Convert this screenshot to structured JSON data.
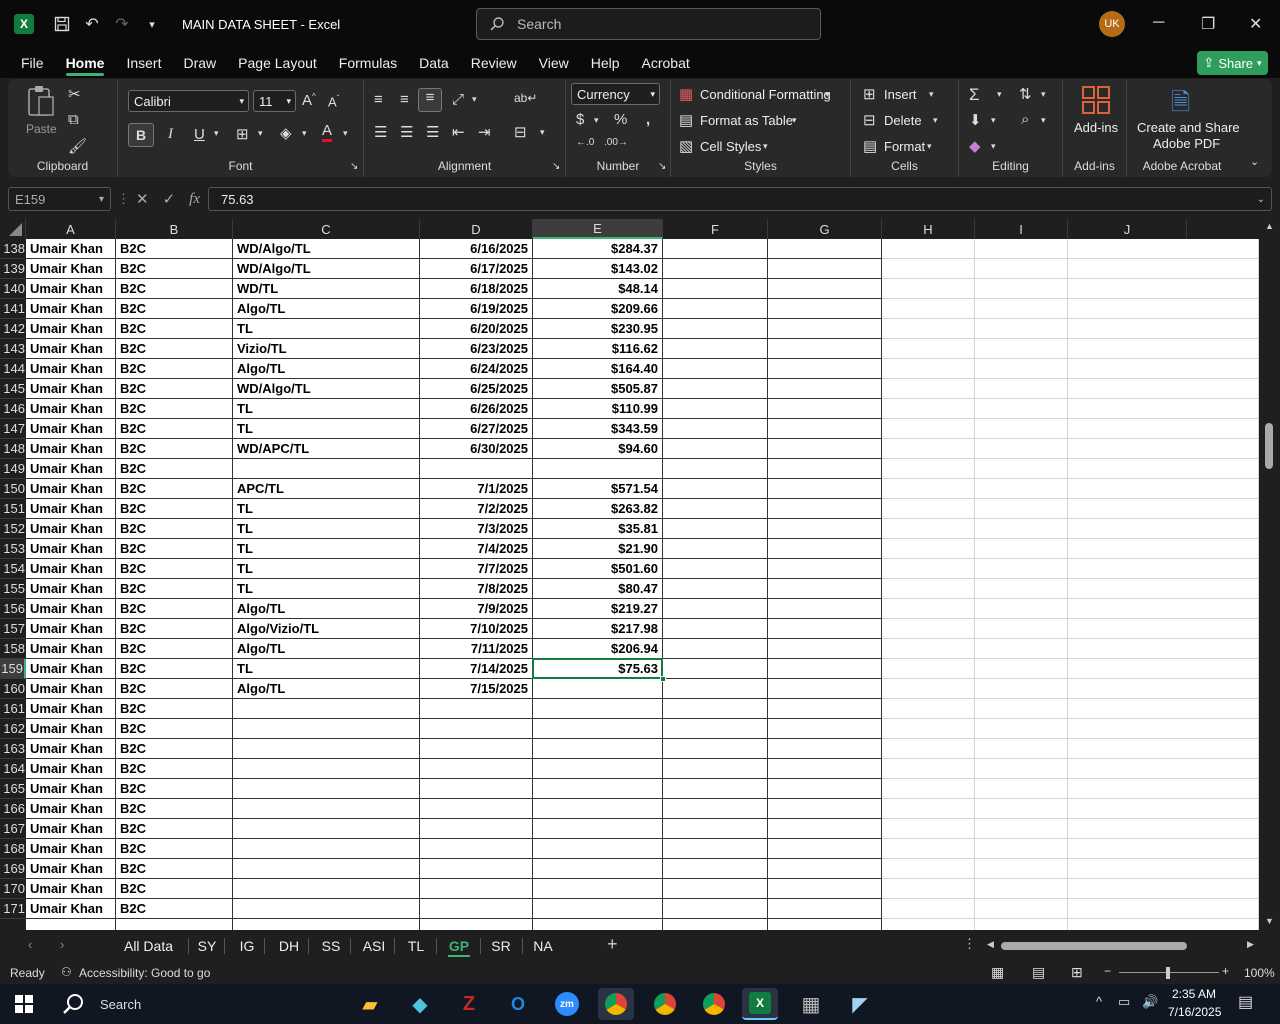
{
  "window": {
    "title": "MAIN DATA SHEET  -  Excel",
    "search_placeholder": "Search",
    "user_initials": "UK"
  },
  "menu": {
    "items": [
      "File",
      "Home",
      "Insert",
      "Draw",
      "Page Layout",
      "Formulas",
      "Data",
      "Review",
      "View",
      "Help",
      "Acrobat"
    ],
    "active": "Home",
    "share_label": "Share"
  },
  "ribbon": {
    "clipboard": {
      "label": "Clipboard",
      "paste": "Paste"
    },
    "font": {
      "label": "Font",
      "family": "Calibri",
      "size": "11",
      "bold": "B",
      "italic": "I",
      "underline": "U"
    },
    "alignment": {
      "label": "Alignment"
    },
    "number": {
      "label": "Number",
      "format": "Currency"
    },
    "styles": {
      "label": "Styles",
      "conditional": "Conditional Formatting",
      "table": "Format as Table",
      "cell_styles": "Cell Styles"
    },
    "cells": {
      "label": "Cells",
      "insert": "Insert",
      "delete": "Delete",
      "format": "Format"
    },
    "editing": {
      "label": "Editing"
    },
    "addins": {
      "label": "Add-ins",
      "button": "Add-ins"
    },
    "acrobat": {
      "label": "Adobe Acrobat",
      "button_line1": "Create and Share",
      "button_line2": "Adobe PDF"
    }
  },
  "formula_bar": {
    "name_box": "E159",
    "fx": "fx",
    "value": "75.63"
  },
  "columns": [
    "A",
    "B",
    "C",
    "D",
    "E",
    "F",
    "G",
    "H",
    "I",
    "J"
  ],
  "selected_column": "E",
  "selected_row": "159",
  "rows": [
    {
      "n": "138",
      "a": "Umair Khan",
      "b": "B2C",
      "c": "WD/Algo/TL",
      "d": "6/16/2025",
      "e": "$284.37"
    },
    {
      "n": "139",
      "a": "Umair Khan",
      "b": "B2C",
      "c": "WD/Algo/TL",
      "d": "6/17/2025",
      "e": "$143.02"
    },
    {
      "n": "140",
      "a": "Umair Khan",
      "b": "B2C",
      "c": "WD/TL",
      "d": "6/18/2025",
      "e": "$48.14"
    },
    {
      "n": "141",
      "a": "Umair Khan",
      "b": "B2C",
      "c": "Algo/TL",
      "d": "6/19/2025",
      "e": "$209.66"
    },
    {
      "n": "142",
      "a": "Umair Khan",
      "b": "B2C",
      "c": "TL",
      "d": "6/20/2025",
      "e": "$230.95"
    },
    {
      "n": "143",
      "a": "Umair Khan",
      "b": "B2C",
      "c": "Vizio/TL",
      "d": "6/23/2025",
      "e": "$116.62"
    },
    {
      "n": "144",
      "a": "Umair Khan",
      "b": "B2C",
      "c": "Algo/TL",
      "d": "6/24/2025",
      "e": "$164.40"
    },
    {
      "n": "145",
      "a": "Umair Khan",
      "b": "B2C",
      "c": "WD/Algo/TL",
      "d": "6/25/2025",
      "e": "$505.87"
    },
    {
      "n": "146",
      "a": "Umair Khan",
      "b": "B2C",
      "c": "TL",
      "d": "6/26/2025",
      "e": "$110.99"
    },
    {
      "n": "147",
      "a": "Umair Khan",
      "b": "B2C",
      "c": "TL",
      "d": "6/27/2025",
      "e": "$343.59"
    },
    {
      "n": "148",
      "a": "Umair Khan",
      "b": "B2C",
      "c": "WD/APC/TL",
      "d": "6/30/2025",
      "e": "$94.60"
    },
    {
      "n": "149",
      "a": "Umair Khan",
      "b": "B2C",
      "c": "",
      "d": "",
      "e": ""
    },
    {
      "n": "150",
      "a": "Umair Khan",
      "b": "B2C",
      "c": "APC/TL",
      "d": "7/1/2025",
      "e": "$571.54"
    },
    {
      "n": "151",
      "a": "Umair Khan",
      "b": "B2C",
      "c": "TL",
      "d": "7/2/2025",
      "e": "$263.82"
    },
    {
      "n": "152",
      "a": "Umair Khan",
      "b": "B2C",
      "c": "TL",
      "d": "7/3/2025",
      "e": "$35.81"
    },
    {
      "n": "153",
      "a": "Umair Khan",
      "b": "B2C",
      "c": "TL",
      "d": "7/4/2025",
      "e": "$21.90"
    },
    {
      "n": "154",
      "a": "Umair Khan",
      "b": "B2C",
      "c": "TL",
      "d": "7/7/2025",
      "e": "$501.60"
    },
    {
      "n": "155",
      "a": "Umair Khan",
      "b": "B2C",
      "c": "TL",
      "d": "7/8/2025",
      "e": "$80.47"
    },
    {
      "n": "156",
      "a": "Umair Khan",
      "b": "B2C",
      "c": "Algo/TL",
      "d": "7/9/2025",
      "e": "$219.27"
    },
    {
      "n": "157",
      "a": "Umair Khan",
      "b": "B2C",
      "c": "Algo/Vizio/TL",
      "d": "7/10/2025",
      "e": "$217.98"
    },
    {
      "n": "158",
      "a": "Umair Khan",
      "b": "B2C",
      "c": "Algo/TL",
      "d": "7/11/2025",
      "e": "$206.94"
    },
    {
      "n": "159",
      "a": "Umair Khan",
      "b": "B2C",
      "c": "TL",
      "d": "7/14/2025",
      "e": "$75.63"
    },
    {
      "n": "160",
      "a": "Umair Khan",
      "b": "B2C",
      "c": "Algo/TL",
      "d": "7/15/2025",
      "e": ""
    },
    {
      "n": "161",
      "a": "Umair Khan",
      "b": "B2C",
      "c": "",
      "d": "",
      "e": ""
    },
    {
      "n": "162",
      "a": "Umair Khan",
      "b": "B2C",
      "c": "",
      "d": "",
      "e": ""
    },
    {
      "n": "163",
      "a": "Umair Khan",
      "b": "B2C",
      "c": "",
      "d": "",
      "e": ""
    },
    {
      "n": "164",
      "a": "Umair Khan",
      "b": "B2C",
      "c": "",
      "d": "",
      "e": ""
    },
    {
      "n": "165",
      "a": "Umair Khan",
      "b": "B2C",
      "c": "",
      "d": "",
      "e": ""
    },
    {
      "n": "166",
      "a": "Umair Khan",
      "b": "B2C",
      "c": "",
      "d": "",
      "e": ""
    },
    {
      "n": "167",
      "a": "Umair Khan",
      "b": "B2C",
      "c": "",
      "d": "",
      "e": ""
    },
    {
      "n": "168",
      "a": "Umair Khan",
      "b": "B2C",
      "c": "",
      "d": "",
      "e": ""
    },
    {
      "n": "169",
      "a": "Umair Khan",
      "b": "B2C",
      "c": "",
      "d": "",
      "e": ""
    },
    {
      "n": "170",
      "a": "Umair Khan",
      "b": "B2C",
      "c": "",
      "d": "",
      "e": ""
    },
    {
      "n": "171",
      "a": "Umair Khan",
      "b": "B2C",
      "c": "",
      "d": "",
      "e": ""
    }
  ],
  "sheet_tabs": [
    "All Data",
    "SY",
    "IG",
    "DH",
    "SS",
    "ASI",
    "TL",
    "GP",
    "SR",
    "NA"
  ],
  "active_tab": "GP",
  "status": {
    "ready": "Ready",
    "accessibility": "Accessibility: Good to go",
    "zoom": "100%"
  },
  "taskbar": {
    "search": "Search",
    "time": "2:35 AM",
    "date": "7/16/2025"
  },
  "colors": {
    "accent": "#107c41",
    "green_ui": "#3fb377"
  }
}
